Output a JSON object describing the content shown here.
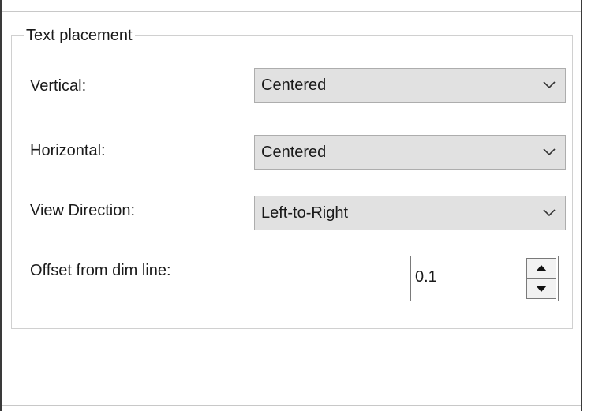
{
  "group": {
    "title": "Text placement"
  },
  "fields": {
    "vertical": {
      "label": "Vertical:",
      "value": "Centered"
    },
    "horizontal": {
      "label": "Horizontal:",
      "value": "Centered"
    },
    "view_direction": {
      "label": "View Direction:",
      "value": "Left-to-Right"
    },
    "offset": {
      "label": "Offset from dim line:",
      "value": "0.1"
    }
  },
  "icons": {
    "dropdown": "chevron-down-icon",
    "spin_up": "triangle-up-icon",
    "spin_down": "triangle-down-icon"
  },
  "colors": {
    "combo_background": "#e1e1e1",
    "combo_border": "#adadad",
    "group_border": "#d0d0d0"
  }
}
